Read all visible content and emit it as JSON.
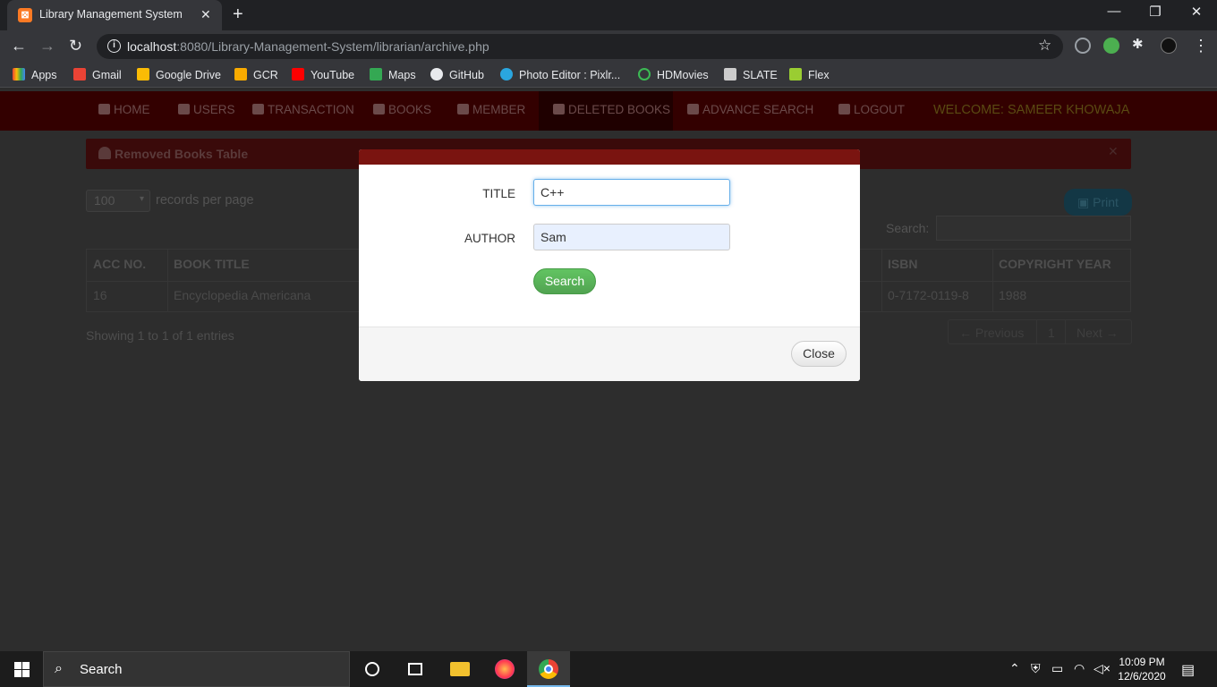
{
  "browser": {
    "tab_title": "Library Management System",
    "url_host": "localhost",
    "url_rest": ":8080/Library-Management-System/librarian/archive.php",
    "bookmarks": [
      "Apps",
      "Gmail",
      "Google Drive",
      "GCR",
      "YouTube",
      "Maps",
      "GitHub",
      "Photo Editor : Pixlr...",
      "HDMovies",
      "SLATE",
      "Flex"
    ]
  },
  "navbar": {
    "items": [
      "HOME",
      "USERS",
      "TRANSACTION",
      "BOOKS",
      "MEMBER",
      "DELETED BOOKS",
      "ADVANCE SEARCH",
      "LOGOUT"
    ],
    "welcome": "WELCOME: SAMEER KHOWAJA"
  },
  "panel": {
    "title": "Removed Books Table",
    "records_value": "100",
    "records_label": "records per page",
    "print_label": "Print",
    "search_label": "Search:"
  },
  "table": {
    "headers": [
      "ACC NO.",
      "BOOK TITLE",
      "ISBN",
      "COPYRIGHT YEAR"
    ],
    "rows": [
      [
        "16",
        "Encyclopedia Americana",
        "0-7172-0119-8",
        "1988"
      ]
    ]
  },
  "footer": {
    "showing": "Showing 1 to 1 of 1 entries",
    "prev": "← Previous",
    "page": "1",
    "next": "Next →"
  },
  "modal": {
    "title_label": "TITLE",
    "title_value": "C++",
    "author_label": "AUTHOR",
    "author_value": "Sam",
    "search_btn": "Search",
    "close_btn": "Close"
  },
  "taskbar": {
    "search_placeholder": "Search",
    "time": "10:09 PM",
    "date": "12/6/2020"
  },
  "colors": {
    "navbar_bg": "#330000",
    "modal_header": "#7a1410",
    "search_btn": "#5cb85c"
  }
}
